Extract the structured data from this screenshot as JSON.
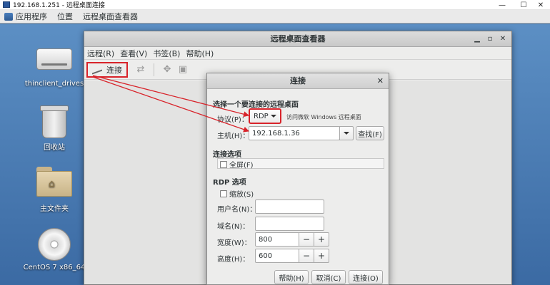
{
  "outer_window": {
    "title": "192.168.1.251 - 远程桌面连接"
  },
  "top_panel": {
    "menus": [
      "应用程序",
      "位置",
      "远程桌面查看器"
    ]
  },
  "desktop_icons": [
    {
      "label": "thinclient_drives"
    },
    {
      "label": "回收站"
    },
    {
      "label": "主文件夹"
    },
    {
      "label": "CentOS 7 x86_64"
    }
  ],
  "viewer": {
    "title": "远程桌面查看器",
    "menus": [
      "远程(R)",
      "查看(V)",
      "书签(B)",
      "帮助(H)"
    ],
    "toolbar": {
      "connect_label": "连接"
    }
  },
  "dialog": {
    "title": "连接",
    "section_remote": "选择一个要连接的远程桌面",
    "protocol_label": "协议(P)：",
    "protocol_value": "RDP",
    "protocol_hint": "访问微软 Windows 远程桌面",
    "host_label": "主机(H)：",
    "host_value": "192.168.1.36",
    "find_button": "查找(F)",
    "section_connection": "连接选项",
    "fullscreen_label": "全屏(F)",
    "section_rdp": "RDP 选项",
    "scale_label": "缩放(S)",
    "username_label": "用户名(N)：",
    "username_value": "",
    "domain_label": "域名(N)：",
    "domain_value": "",
    "width_label": "宽度(W)：",
    "width_value": "800",
    "height_label": "高度(H)：",
    "height_value": "600",
    "minus": "−",
    "plus": "+",
    "help_button": "帮助(H)",
    "cancel_button": "取消(C)",
    "connect_button": "连接(O)"
  },
  "colors": {
    "annotation_red": "#d8232a",
    "desktop_blue": "#3d6b9e"
  },
  "icons": [
    "app-icon",
    "minimize-icon",
    "maximize-icon",
    "close-icon",
    "applications-icon",
    "drive-icon",
    "trash-icon",
    "home-folder-icon",
    "disc-icon",
    "connect-plug-icon",
    "send-keys-icon",
    "fullscreen-icon",
    "screenshot-icon"
  ]
}
